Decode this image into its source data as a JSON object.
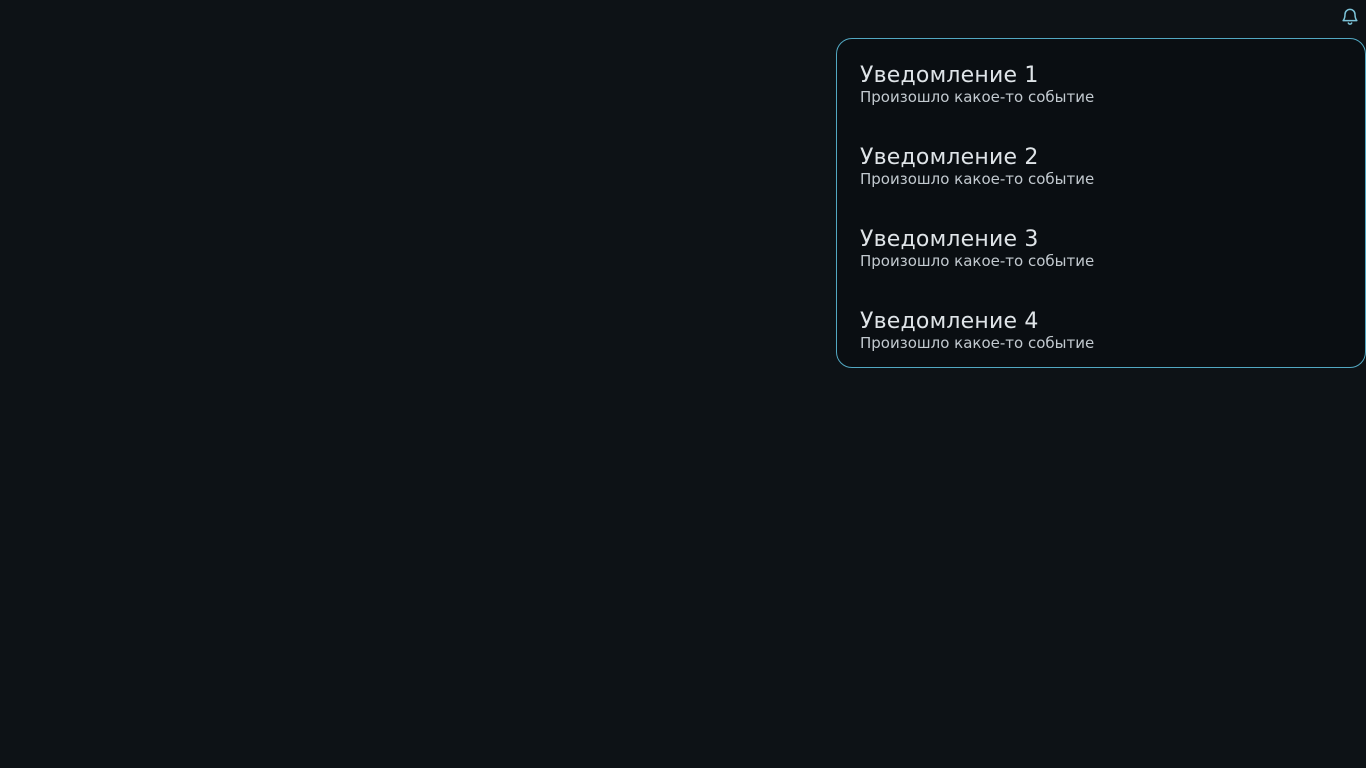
{
  "header": {
    "bell_icon": "bell-icon",
    "icon_color": "#7cc3d8"
  },
  "panel": {
    "border_color": "#52a8c2",
    "items": [
      {
        "title": "Уведомление 1",
        "text": "Произошло какое-то событие"
      },
      {
        "title": "Уведомление 2",
        "text": "Произошло какое-то событие"
      },
      {
        "title": "Уведомление 3",
        "text": "Произошло какое-то событие"
      },
      {
        "title": "Уведомление 4",
        "text": "Произошло какое-то событие"
      }
    ]
  },
  "colors": {
    "background": "#0d1216",
    "panel_background": "#0a0e12",
    "title_text": "#dfe4e8",
    "body_text": "#c2c9cf"
  }
}
